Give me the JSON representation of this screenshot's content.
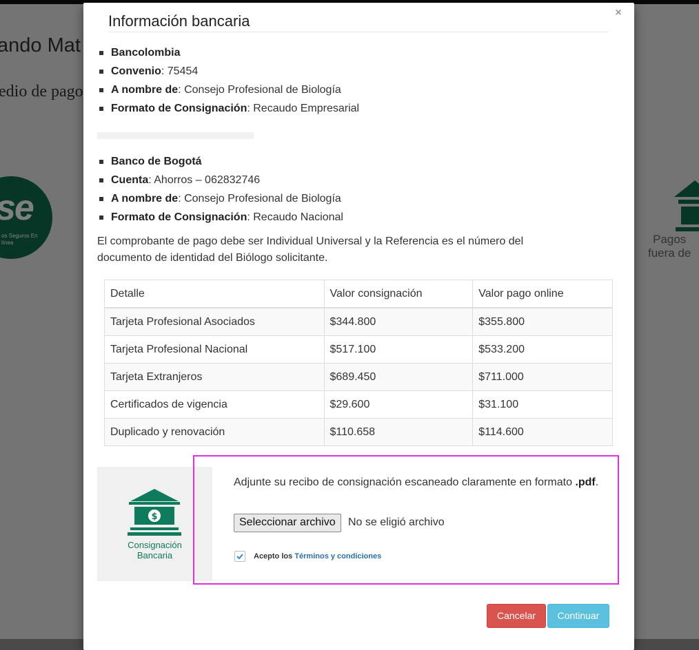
{
  "background": {
    "title": "ando Mat",
    "subtitle": "edio de pago",
    "pse_logo_text": "se",
    "pse_logo_small": "os Seguros En línea",
    "right_label_line1": "Pagos",
    "right_label_line2": "fuera de"
  },
  "modal": {
    "title": "Información bancaria",
    "close_icon": "×",
    "bank1": [
      {
        "label": "Bancolombia",
        "value": ""
      },
      {
        "label": "Convenio",
        "value": ": 75454"
      },
      {
        "label": "A nombre de",
        "value": ": Consejo Profesional de Biología"
      },
      {
        "label": "Formato de Consignación",
        "value": ": Recaudo Empresarial"
      }
    ],
    "bank2": [
      {
        "label": "Banco de Bogotá",
        "value": ""
      },
      {
        "label": "Cuenta",
        "value": ": Ahorros – 062832746"
      },
      {
        "label": "A nombre de",
        "value": ": Consejo Profesional de Biología"
      },
      {
        "label": "Formato de Consignación",
        "value": ": Recaudo Nacional"
      }
    ],
    "note": "El comprobante de pago debe ser Individual Universal y la Referencia es el número del documento de identidad del Biólogo solicitante.",
    "table": {
      "headers": [
        "Detalle",
        "Valor consignación",
        "Valor pago online"
      ],
      "rows": [
        [
          "Tarjeta Profesional Asociados",
          "$344.800",
          "$355.800"
        ],
        [
          "Tarjeta Profesional Nacional",
          "$517.100",
          "$533.200"
        ],
        [
          "Tarjeta Extranjeros",
          "$689.450",
          "$711.000"
        ],
        [
          "Certificados de vigencia",
          "$29.600",
          "$31.100"
        ],
        [
          "Duplicado y renovación",
          "$110.658",
          "$114.600"
        ]
      ]
    },
    "payment_method": {
      "label_line1": "Consignación",
      "label_line2": "Bancaria",
      "icon_color": "#0f7b5d"
    },
    "upload": {
      "instruction": "Adjunte su recibo de consignación escaneado claramente en formato",
      "format": ".pdf",
      "period": ".",
      "file_button": "Seleccionar archivo",
      "file_status": "No se eligió archivo",
      "accept_prefix": "Acepto los",
      "terms_link": "Términos y condiciones",
      "accepted": true
    },
    "buttons": {
      "cancel": "Cancelar",
      "continue": "Continuar"
    }
  }
}
